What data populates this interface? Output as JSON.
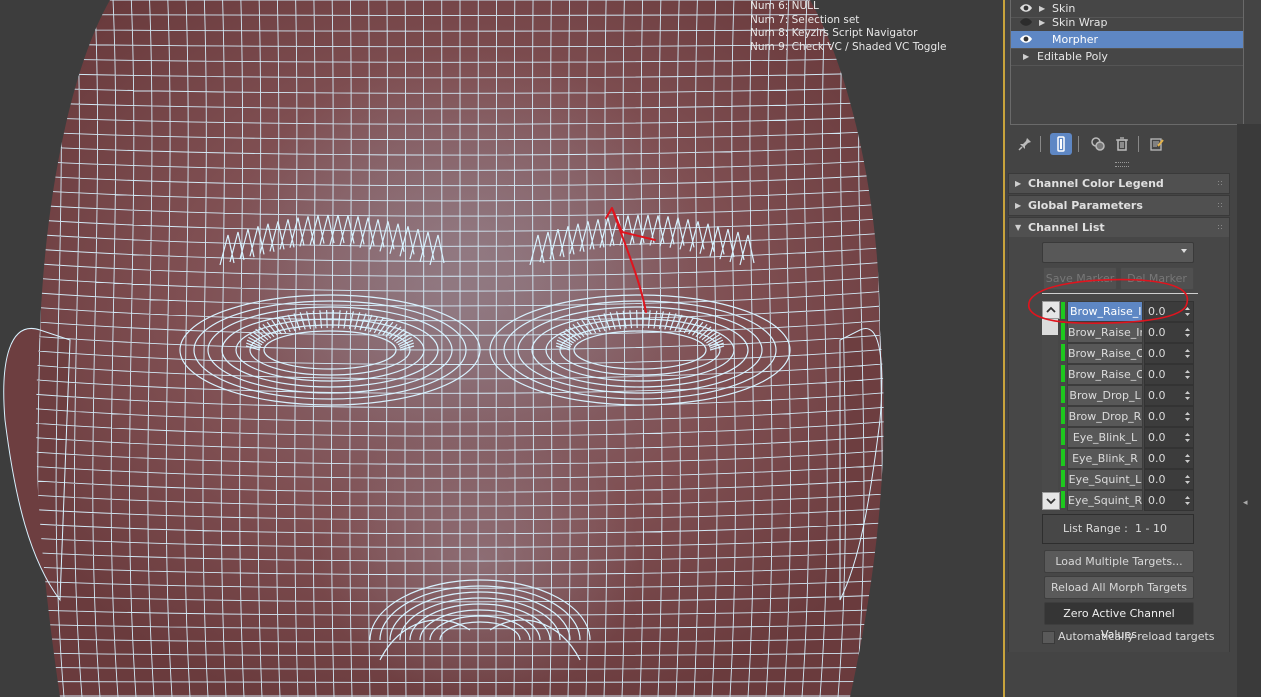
{
  "viewport": {
    "overlay_lines": [
      "Num 6: NULL",
      "Num 7: Selection set",
      "Num 8: Keyzirs Script Navigator",
      "Num 9: Check VC / Shaded VC Toggle"
    ]
  },
  "modifier_stack": {
    "items": [
      {
        "label": "Skin",
        "eye": "eye-icon",
        "expand": true
      },
      {
        "label": "Skin Wrap",
        "eye": "eye-off-icon",
        "expand": true
      },
      {
        "label": "Morpher",
        "eye": "eye-icon",
        "expand": false,
        "selected": true
      },
      {
        "label": "Editable Poly",
        "eye": null,
        "expand": true
      }
    ]
  },
  "toolbar": {
    "icons": [
      "pin-icon",
      "show-end-result-icon",
      "make-unique-icon",
      "remove-modifier-icon",
      "configure-modifier-sets-icon"
    ]
  },
  "rollouts": {
    "legend": "Channel Color Legend",
    "global": "Global Parameters",
    "channel_list": "Channel List"
  },
  "channel_list": {
    "marker_dropdown_value": "",
    "save_marker": "Save Marker",
    "del_marker": "Del Marker",
    "channels": [
      {
        "name": "Brow_Raise_Inner_L",
        "value": "0.0",
        "selected": true
      },
      {
        "name": "Brow_Raise_Inner_R",
        "value": "0.0"
      },
      {
        "name": "Brow_Raise_Outer_L",
        "value": "0.0"
      },
      {
        "name": "Brow_Raise_Outer_R",
        "value": "0.0"
      },
      {
        "name": "Brow_Drop_L",
        "value": "0.0"
      },
      {
        "name": "Brow_Drop_R",
        "value": "0.0"
      },
      {
        "name": "Eye_Blink_L",
        "value": "0.0"
      },
      {
        "name": "Eye_Blink_R",
        "value": "0.0"
      },
      {
        "name": "Eye_Squint_L",
        "value": "0.0"
      },
      {
        "name": "Eye_Squint_R",
        "value": "0.0"
      }
    ],
    "list_range_label": "List Range :",
    "list_range_value": "1 - 10",
    "load_multiple": "Load Multiple Targets...",
    "reload_all": "Reload All Morph Targets",
    "zero_active": "Zero Active Channel Values",
    "auto_reload_label": "Automatically reload targets",
    "auto_reload_checked": false
  },
  "colors": {
    "selection": "#5e87c4",
    "channel_active": "#1ec81e",
    "viewport_border": "#c8a33c",
    "annotation": "#e0141e",
    "wireframe": "#d8f2ff"
  }
}
